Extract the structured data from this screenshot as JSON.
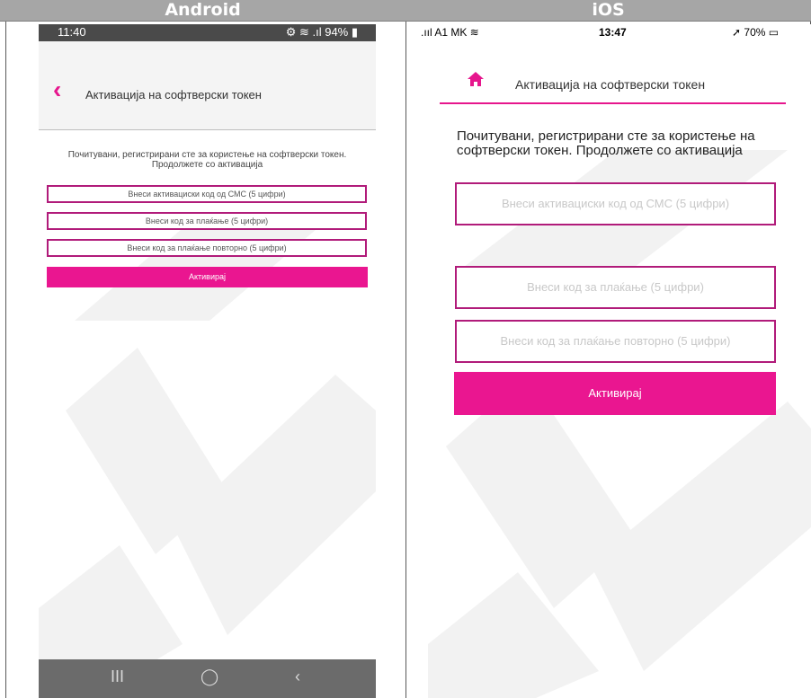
{
  "headers": {
    "android": "Android",
    "ios": "iOS"
  },
  "android": {
    "status": {
      "time": "11:40",
      "system": "⚙ ≋ .ıl 94% ▮"
    },
    "title": "Активација на софтверски токен",
    "message_line1": "Почитувани, регистрирани сте за користење на софтверски токен.",
    "message_line2": "Продолжете со активација",
    "inputs": [
      "Внеси активациски код од СМС (5 цифри)",
      "Внеси код за плаќање (5 цифри)",
      "Внеси код за плаќање повторно (5 цифри)"
    ],
    "button": "Активирај",
    "nav": {
      "recents": "III",
      "home": "◯",
      "back": "‹"
    }
  },
  "ios": {
    "status": {
      "carrier": ".ııl A1 MK ≋",
      "time": "13:47",
      "battery": "➚ 70% ▭"
    },
    "title": "Активација на софтверски токен",
    "message_line1": "Почитувани, регистрирани сте за користење на",
    "message_line2": "софтверски токен. Продолжете со активација",
    "inputs": [
      "Внеси активациски код од СМС (5 цифри)",
      "Внеси код за плаќање (5 цифри)",
      "Внеси код за плаќање повторно (5 цифри)"
    ],
    "button": "Активирај"
  },
  "colors": {
    "accent": "#e6168d",
    "border": "#b11b7a",
    "header": "#a6a6a6"
  }
}
